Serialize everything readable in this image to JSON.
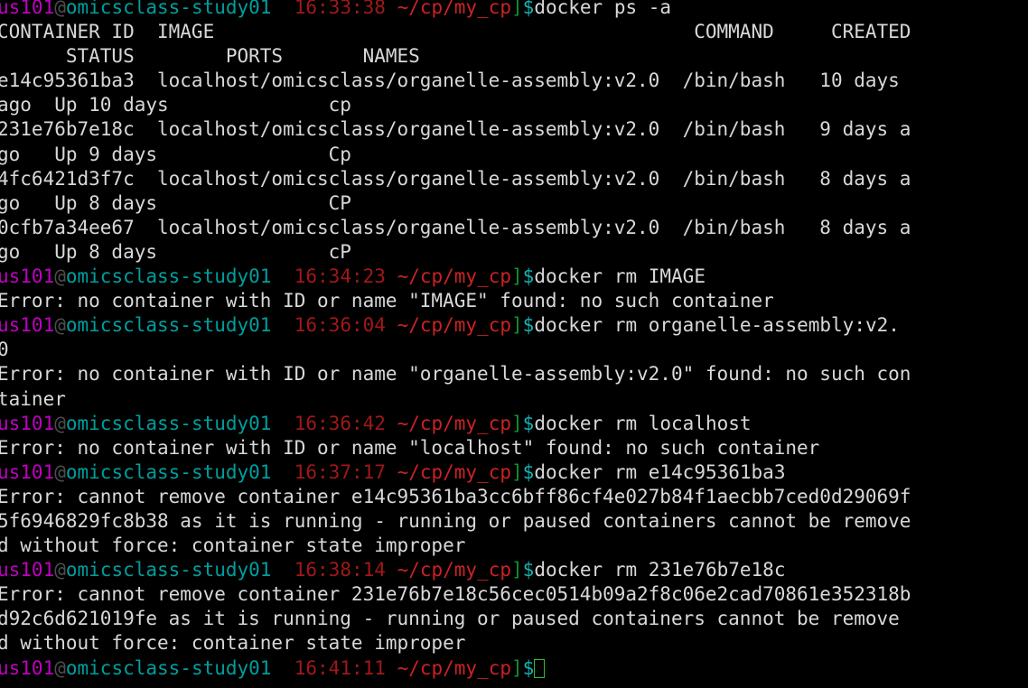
{
  "terminal": {
    "title": "Terminal",
    "background_color": "#000000",
    "foreground_color": "#d8d8d8",
    "cursor_color": "#2fbf2f",
    "colors": {
      "user": "#c000c0",
      "at": "#4e4e4e",
      "host": "#009e9e",
      "time": "#a01818",
      "path": "#cc2222",
      "bracket": "#0f8f2f",
      "dollar": "#12b4b4",
      "output": "#d8d8d8"
    },
    "prompt": {
      "user": "us101",
      "at": "@",
      "host": "omicsclass-study01",
      "path": "~/cp/my_cp",
      "bracket": "]",
      "dollar": "$"
    },
    "lines": [
      {
        "type": "prompt",
        "time": "16:33:38",
        "command": "docker ps -a"
      },
      {
        "type": "output",
        "text": "CONTAINER ID  IMAGE                                          COMMAND     CREATED"
      },
      {
        "type": "output",
        "text": "      STATUS        PORTS       NAMES"
      },
      {
        "type": "output",
        "text": "e14c95361ba3  localhost/omicsclass/organelle-assembly:v2.0  /bin/bash   10 days"
      },
      {
        "type": "output",
        "text": "ago  Up 10 days              cp"
      },
      {
        "type": "output",
        "text": "231e76b7e18c  localhost/omicsclass/organelle-assembly:v2.0  /bin/bash   9 days a"
      },
      {
        "type": "output",
        "text": "go   Up 9 days               Cp"
      },
      {
        "type": "output",
        "text": "4fc6421d3f7c  localhost/omicsclass/organelle-assembly:v2.0  /bin/bash   8 days a"
      },
      {
        "type": "output",
        "text": "go   Up 8 days               CP"
      },
      {
        "type": "output",
        "text": "0cfb7a34ee67  localhost/omicsclass/organelle-assembly:v2.0  /bin/bash   8 days a"
      },
      {
        "type": "output",
        "text": "go   Up 8 days               cP"
      },
      {
        "type": "prompt",
        "time": "16:34:23",
        "command": "docker rm IMAGE"
      },
      {
        "type": "output",
        "text": "Error: no container with ID or name \"IMAGE\" found: no such container"
      },
      {
        "type": "prompt",
        "time": "16:36:04",
        "command": "docker rm organelle-assembly:v2."
      },
      {
        "type": "output",
        "text": "0"
      },
      {
        "type": "output",
        "text": "Error: no container with ID or name \"organelle-assembly:v2.0\" found: no such con"
      },
      {
        "type": "output",
        "text": "tainer"
      },
      {
        "type": "prompt",
        "time": "16:36:42",
        "command": "docker rm localhost"
      },
      {
        "type": "output",
        "text": "Error: no container with ID or name \"localhost\" found: no such container"
      },
      {
        "type": "prompt",
        "time": "16:37:17",
        "command": "docker rm e14c95361ba3"
      },
      {
        "type": "output",
        "text": "Error: cannot remove container e14c95361ba3cc6bff86cf4e027b84f1aecbb7ced0d29069f"
      },
      {
        "type": "output",
        "text": "5f6946829fc8b38 as it is running - running or paused containers cannot be remove"
      },
      {
        "type": "output",
        "text": "d without force: container state improper"
      },
      {
        "type": "prompt",
        "time": "16:38:14",
        "command": "docker rm 231e76b7e18c"
      },
      {
        "type": "output",
        "text": "Error: cannot remove container 231e76b7e18c56cec0514b09a2f8c06e2cad70861e352318b"
      },
      {
        "type": "output",
        "text": "d92c6d621019fe as it is running - running or paused containers cannot be remove"
      },
      {
        "type": "output",
        "text": "d without force: container state improper"
      },
      {
        "type": "prompt",
        "time": "16:41:11",
        "command": "",
        "cursor": true
      }
    ]
  }
}
